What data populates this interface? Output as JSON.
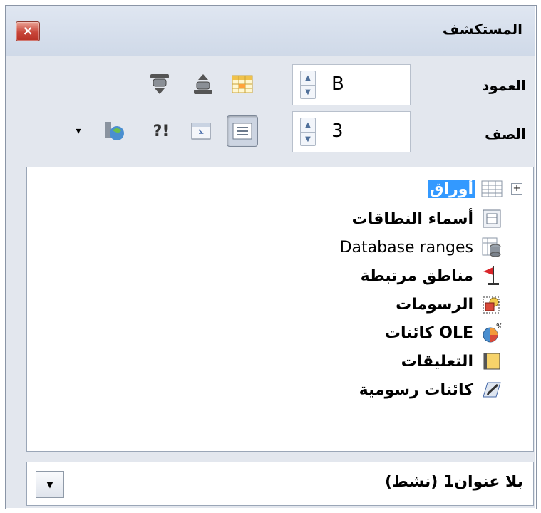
{
  "window": {
    "title": "المستكشف",
    "close_glyph": "×"
  },
  "fields": {
    "column": {
      "label": "العمود",
      "value": "B",
      "up": "▲",
      "down": "▼"
    },
    "row": {
      "label": "الصف",
      "value": "3",
      "up": "▲",
      "down": "▼"
    }
  },
  "toolbar": {
    "icons": [
      "data-range-icon",
      "start-icon",
      "end-icon",
      "content-view-icon",
      "toggle-icon",
      "scenarios-icon",
      "drag-mode-icon",
      "dropdown-arrow-icon"
    ],
    "scenario_glyph": "?!",
    "dropdown_glyph": "▾"
  },
  "tree": {
    "expander": "+",
    "items": [
      {
        "label": "أوراق",
        "icon": "sheet-icon",
        "selected": true
      },
      {
        "label": "أسماء النطاقات",
        "icon": "range-names-icon"
      },
      {
        "label": "Database ranges",
        "icon": "database-icon"
      },
      {
        "label": "مناطق مرتبطة",
        "icon": "linked-areas-icon"
      },
      {
        "label": "الرسومات",
        "icon": "images-icon"
      },
      {
        "label": "كائنات OLE",
        "icon": "ole-objects-icon"
      },
      {
        "label": "التعليقات",
        "icon": "comments-icon"
      },
      {
        "label": "كائنات رسومية",
        "icon": "drawing-objects-icon"
      }
    ]
  },
  "document": {
    "value": "بلا عنوان1 (نشط)",
    "dropdown_glyph": "▼"
  },
  "colors": {
    "accent_selected": "#3399ff",
    "window_bg": "#e3e7ee",
    "close": "#c8463a"
  }
}
